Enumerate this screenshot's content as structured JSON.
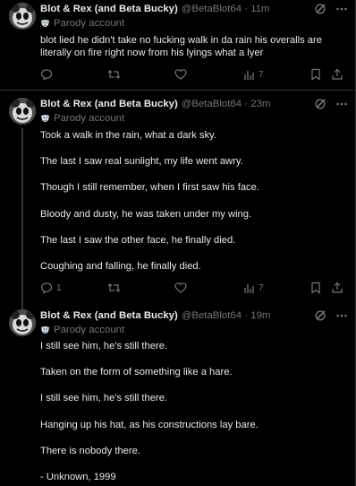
{
  "tweets": [
    {
      "author": "Blot & Rex (and Beta Bucky)",
      "handle": "@BetaBlot64",
      "time": "11m",
      "badge": "Parody account",
      "lines": [
        "blot lied he didn't take no fucking walk in da rain his overalls are",
        "literally on fire right now from his lyings what a lyer"
      ],
      "replies": "",
      "views": "7"
    },
    {
      "author": "Blot & Rex (and Beta Bucky)",
      "handle": "@BetaBlot64",
      "time": "23m",
      "badge": "Parody account",
      "lines": [
        "Took a walk in the rain, what a dark sky.",
        "The last I saw real sunlight, my life went awry.",
        "Though I still remember, when I first saw his face.",
        "Bloody and dusty, he was taken under my wing.",
        "The last I saw the other face, he finally died.",
        "Coughing and falling, he finally died."
      ],
      "replies": "1",
      "views": "7"
    },
    {
      "author": "Blot & Rex (and Beta Bucky)",
      "handle": "@BetaBlot64",
      "time": "19m",
      "badge": "Parody account",
      "lines": [
        "I still see him, he's still there.",
        "Taken on the form of something like a hare.",
        "I still see him, he's still there.",
        "Hanging up his hat, as his constructions lay bare.",
        "There is nobody there.",
        "- Unknown, 1999"
      ]
    }
  ],
  "separator": " · ",
  "colors": {
    "background": "#000000",
    "text": "#e7e9ea",
    "muted": "#71767b",
    "border": "#2f3336"
  },
  "icons": [
    "grok-icon",
    "more-icon",
    "parody-mask-icon",
    "reply-icon",
    "retweet-icon",
    "like-icon",
    "views-icon",
    "bookmark-icon",
    "share-icon"
  ]
}
